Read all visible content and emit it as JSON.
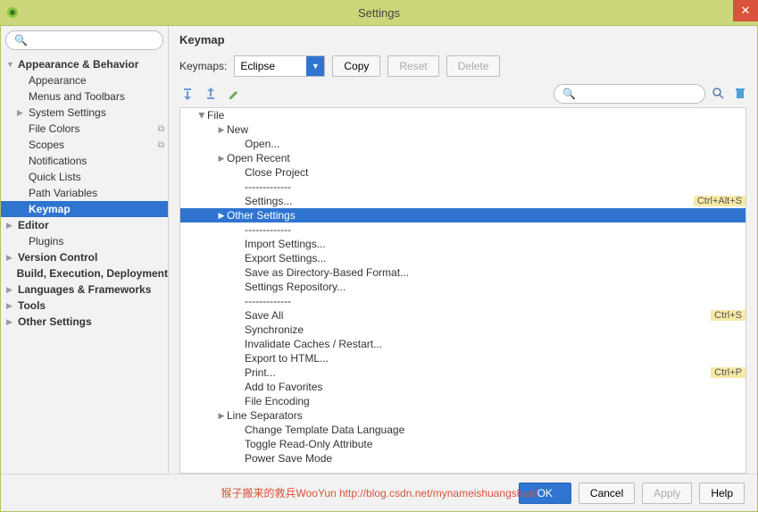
{
  "window": {
    "title": "Settings"
  },
  "sidebar": {
    "search_placeholder": "",
    "items": [
      {
        "label": "Appearance & Behavior",
        "depth": 0,
        "bold": true,
        "arrow": "down"
      },
      {
        "label": "Appearance",
        "depth": 1
      },
      {
        "label": "Menus and Toolbars",
        "depth": 1
      },
      {
        "label": "System Settings",
        "depth": 1,
        "arrow": "right"
      },
      {
        "label": "File Colors",
        "depth": 1,
        "deco": "⧉"
      },
      {
        "label": "Scopes",
        "depth": 1,
        "deco": "⧉"
      },
      {
        "label": "Notifications",
        "depth": 1
      },
      {
        "label": "Quick Lists",
        "depth": 1
      },
      {
        "label": "Path Variables",
        "depth": 1
      },
      {
        "label": "Keymap",
        "depth": 1,
        "selected": true
      },
      {
        "label": "Editor",
        "depth": 0,
        "bold": true,
        "arrow": "right"
      },
      {
        "label": "Plugins",
        "depth": 1
      },
      {
        "label": "Version Control",
        "depth": 0,
        "bold": true,
        "arrow": "right"
      },
      {
        "label": "Build, Execution, Deployment",
        "depth": 0,
        "bold": true
      },
      {
        "label": "Languages & Frameworks",
        "depth": 0,
        "bold": true,
        "arrow": "right"
      },
      {
        "label": "Tools",
        "depth": 0,
        "bold": true,
        "arrow": "right"
      },
      {
        "label": "Other Settings",
        "depth": 0,
        "bold": true,
        "arrow": "right"
      }
    ]
  },
  "content": {
    "heading": "Keymap",
    "keymaps_label": "Keymaps:",
    "keymaps_value": "Eclipse",
    "copy_btn": "Copy",
    "reset_btn": "Reset",
    "delete_btn": "Delete",
    "search_placeholder": "",
    "list": [
      {
        "label": "File",
        "depth": 0,
        "arrow": "down"
      },
      {
        "label": "New",
        "depth": 1,
        "arrow": "right"
      },
      {
        "label": "Open...",
        "depth": 2
      },
      {
        "label": "Open Recent",
        "depth": 1,
        "arrow": "right"
      },
      {
        "label": "Close Project",
        "depth": 2
      },
      {
        "label": "-------------",
        "depth": 2
      },
      {
        "label": "Settings...",
        "depth": 2,
        "shortcut": "Ctrl+Alt+S"
      },
      {
        "label": "Other Settings",
        "depth": 1,
        "arrow": "right",
        "selected": true
      },
      {
        "label": "-------------",
        "depth": 2
      },
      {
        "label": "Import Settings...",
        "depth": 2
      },
      {
        "label": "Export Settings...",
        "depth": 2
      },
      {
        "label": "Save as Directory-Based Format...",
        "depth": 2
      },
      {
        "label": "Settings Repository...",
        "depth": 2
      },
      {
        "label": "-------------",
        "depth": 2
      },
      {
        "label": "Save All",
        "depth": 2,
        "shortcut": "Ctrl+S"
      },
      {
        "label": "Synchronize",
        "depth": 2
      },
      {
        "label": "Invalidate Caches / Restart...",
        "depth": 2
      },
      {
        "label": "Export to HTML...",
        "depth": 2
      },
      {
        "label": "Print...",
        "depth": 2,
        "shortcut": "Ctrl+P"
      },
      {
        "label": "Add to Favorites",
        "depth": 2
      },
      {
        "label": "File Encoding",
        "depth": 2
      },
      {
        "label": "Line Separators",
        "depth": 1,
        "arrow": "right"
      },
      {
        "label": "Change Template Data Language",
        "depth": 2
      },
      {
        "label": "Toggle Read-Only Attribute",
        "depth": 2
      },
      {
        "label": "Power Save Mode",
        "depth": 2
      }
    ]
  },
  "footer": {
    "watermark": "猴子搬来的救兵WooYun http://blog.csdn.net/mynameishuangshuai",
    "ok": "OK",
    "cancel": "Cancel",
    "apply": "Apply",
    "help": "Help"
  }
}
